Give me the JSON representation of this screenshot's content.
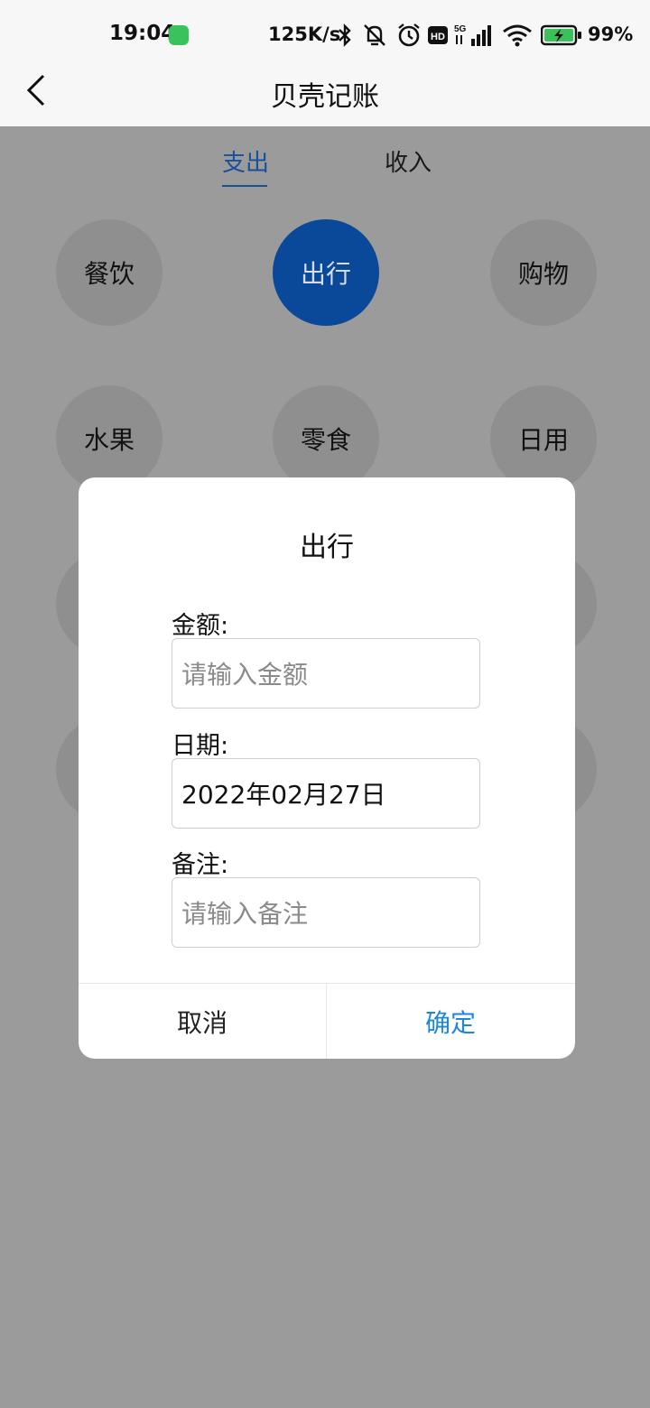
{
  "status_bar": {
    "time": "19:04",
    "speed": "125K/s",
    "network": "5G",
    "battery": "99%",
    "icons": [
      "app-icon",
      "bluetooth-icon",
      "mute-icon",
      "alarm-icon",
      "hd-icon",
      "signal-icon",
      "wifi-icon",
      "battery-icon"
    ]
  },
  "header": {
    "title": "贝壳记账",
    "back_icon": "chevron-left-icon"
  },
  "tabs": [
    {
      "label": "支出",
      "active": true
    },
    {
      "label": "收入",
      "active": false
    }
  ],
  "categories": [
    {
      "label": "餐饮",
      "selected": false
    },
    {
      "label": "出行",
      "selected": true
    },
    {
      "label": "购物",
      "selected": false
    },
    {
      "label": "水果",
      "selected": false
    },
    {
      "label": "零食",
      "selected": false
    },
    {
      "label": "日用",
      "selected": false
    }
  ],
  "dialog": {
    "title": "出行",
    "amount_label": "金额:",
    "amount_placeholder": "请输入金额",
    "date_label": "日期:",
    "date_value": "2022年02月27日",
    "note_label": "备注:",
    "note_placeholder": "请输入备注",
    "cancel": "取消",
    "confirm": "确定"
  },
  "colors": {
    "accent": "#0a489a",
    "confirm_text": "#1f86d9",
    "overlay": "#9b9b9b"
  }
}
